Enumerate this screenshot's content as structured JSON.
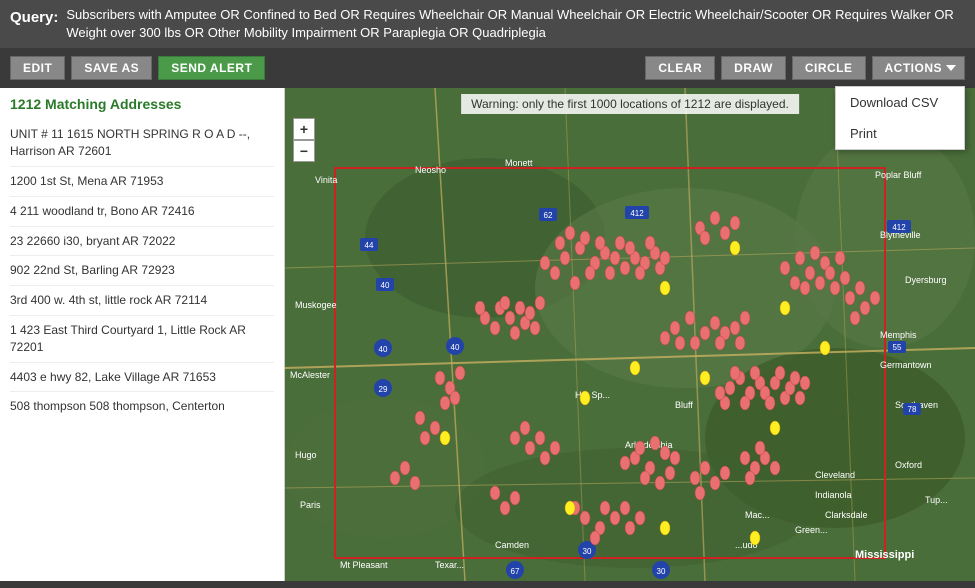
{
  "query": {
    "label": "Query:",
    "text": "Subscribers with Amputee OR Confined to Bed OR Requires Wheelchair OR Manual Wheelchair OR Electric Wheelchair/Scooter OR Requires Walker OR Weight over 300 lbs OR Other Mobility Impairment OR Paraplegia OR Quadriplegia"
  },
  "toolbar": {
    "edit_label": "EDIT",
    "save_as_label": "SAVE AS",
    "send_alert_label": "SEND ALERT",
    "clear_label": "CLEAR",
    "draw_label": "DRAW",
    "circle_label": "CIRCLE",
    "actions_label": "ACTIONS"
  },
  "actions_dropdown": {
    "items": [
      {
        "label": "Download CSV"
      },
      {
        "label": "Print"
      }
    ]
  },
  "map_warning": "Warning: only the first 1000 locations of 1212 are displayed.",
  "address_count": "1212 Matching Addresses",
  "addresses": [
    "UNIT # 11 1615 NORTH SPRING R O A D --, Harrison AR 72601",
    "1200 1st St, Mena AR 71953",
    "4 211 woodland tr, Bono AR 72416",
    "23 22660 i30, bryant AR 72022",
    "902 22nd St, Barling AR 72923",
    "3rd 400 w. 4th st, little rock AR 72114",
    "1 423 East Third Courtyard 1, Little Rock AR 72201",
    "4403 e hwy 82, Lake Village AR 71653",
    "508 thompson 508 thompson, Centerton"
  ],
  "zoom": {
    "in": "+",
    "out": "−"
  }
}
